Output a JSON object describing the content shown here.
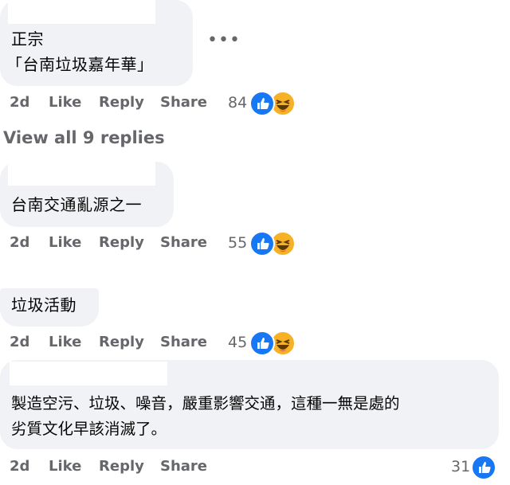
{
  "comments": [
    {
      "lines": [
        "正宗",
        "「台南垃圾嘉年華」"
      ],
      "actions": {
        "time": "2d",
        "like": "Like",
        "reply": "Reply",
        "share": "Share"
      },
      "reaction_count": "84",
      "reactions": [
        "like-icon",
        "haha-icon"
      ]
    },
    {
      "lines": [
        "台南交通亂源之一"
      ],
      "actions": {
        "time": "2d",
        "like": "Like",
        "reply": "Reply",
        "share": "Share"
      },
      "reaction_count": "55",
      "reactions": [
        "like-icon",
        "haha-icon"
      ]
    },
    {
      "lines": [
        "垃圾活動"
      ],
      "actions": {
        "time": "2d",
        "like": "Like",
        "reply": "Reply",
        "share": "Share"
      },
      "reaction_count": "45",
      "reactions": [
        "like-icon",
        "haha-icon"
      ]
    },
    {
      "lines": [
        "製造空污、垃圾、噪音，嚴重影響交通，這種一無是處的",
        "劣質文化早該消滅了。"
      ],
      "actions": {
        "time": "2d",
        "like": "Like",
        "reply": "Reply",
        "share": "Share"
      },
      "reaction_count": "31",
      "reactions": [
        "like-icon"
      ]
    }
  ],
  "view_replies": "View all 9 replies",
  "more_menu": "•••",
  "colors": {
    "bubble": "#f0f2f5",
    "like_blue": "#1877f2",
    "haha_yellow": "#f7b125",
    "secondary_text": "#65676b"
  }
}
